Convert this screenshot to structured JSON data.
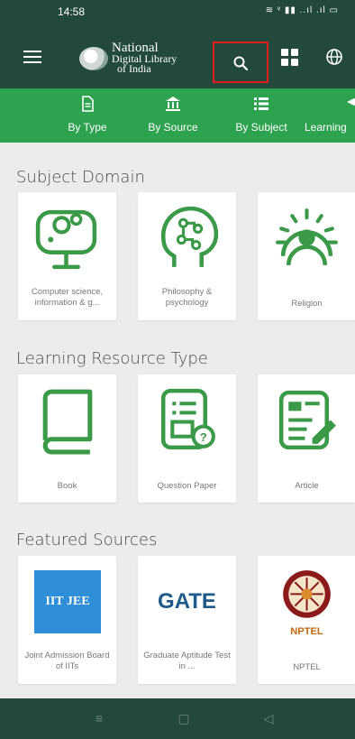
{
  "status_bar": {
    "time": "14:58",
    "indicators": "≋ ᵛ ▮▮ ..ıl .ıl ▭"
  },
  "app_bar": {
    "logo": {
      "line1": "National",
      "line2": "Digital Library",
      "line3": "of India"
    },
    "icons": [
      "menu-icon",
      "search-icon",
      "grid-icon",
      "globe-icon"
    ]
  },
  "tabs": [
    {
      "label": "By Type",
      "icon": "document-icon"
    },
    {
      "label": "By Source",
      "icon": "institution-icon"
    },
    {
      "label": "By Subject",
      "icon": "list-icon"
    },
    {
      "label": "Learning",
      "icon": "learning-icon"
    }
  ],
  "sections": {
    "subject_domain": {
      "title": "Subject Domain",
      "cards": [
        {
          "label": "Computer science, information & g...",
          "icon": "computer-icon"
        },
        {
          "label": "Philosophy & psychology",
          "icon": "brain-icon"
        },
        {
          "label": "Religion",
          "icon": "sun-icon"
        }
      ]
    },
    "learning_resource_type": {
      "title": "Learning Resource Type",
      "cards": [
        {
          "label": "Book",
          "icon": "book-icon"
        },
        {
          "label": "Question Paper",
          "icon": "question-paper-icon"
        },
        {
          "label": "Article",
          "icon": "article-icon"
        }
      ]
    },
    "featured_sources": {
      "title": "Featured Sources",
      "cards": [
        {
          "label": "Joint Admission Board of IITs",
          "logo_text": "IIT JEE",
          "icon": "iit-jee-logo"
        },
        {
          "label": "Graduate Aptitude Test in ...",
          "logo_text": "GATE",
          "icon": "gate-logo"
        },
        {
          "label": "NPTEL",
          "logo_text": "NPTEL",
          "icon": "nptel-logo"
        }
      ]
    }
  },
  "nav_bar": {
    "buttons": [
      "recents-icon",
      "home-icon",
      "back-icon"
    ]
  },
  "colors": {
    "dark_green": "#23493a",
    "green": "#2da24f",
    "icon_green": "#3a9a48",
    "highlight_red": "#e21b1b"
  }
}
